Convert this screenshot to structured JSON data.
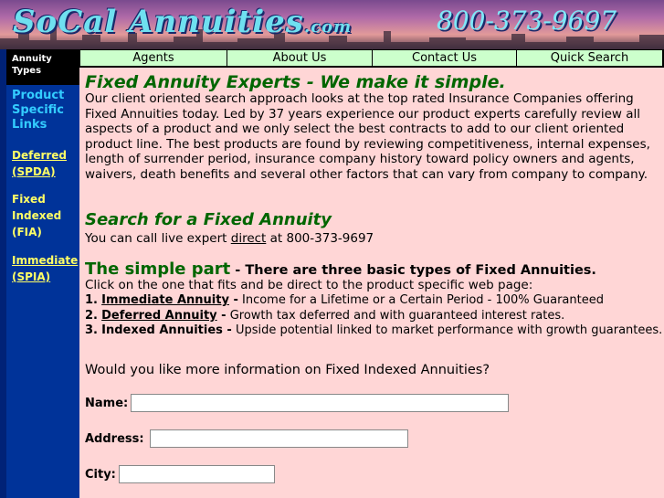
{
  "banner": {
    "logo_main": "SoCal Annuities",
    "logo_suffix": ".com",
    "phone": "800-373-9697"
  },
  "sidebar": {
    "header": "Annuity Types",
    "section_title": "Product Specific Links",
    "deferred": [
      "Deferred",
      "(SPDA)"
    ],
    "fixed_indexed": [
      "Fixed",
      "Indexed",
      "(FIA)"
    ],
    "immediate": [
      "Immediate",
      "(SPIA)"
    ]
  },
  "nav": {
    "tabs": [
      "Agents",
      "About Us",
      "Contact Us",
      "Quick Search"
    ]
  },
  "main": {
    "title": "Fixed Annuity Experts - We make it simple.",
    "intro": "Our client oriented search approach looks at the top rated Insurance Companies offering Fixed Annuities today. Led by 37 years experience our product experts carefully review all aspects of a product and we only select the best contracts to add to our client oriented product line. The best products are found by reviewing competitiveness, internal expenses, length of surrender period, insurance company history toward policy owners and agents, waivers, death benefits and several other factors that can vary from company to company.",
    "search_title": "Search for a Fixed Annuity",
    "call_prefix": "You can call live expert ",
    "call_link": "direct",
    "call_suffix": " at 800-373-9697",
    "simple_big": "The simple part",
    "simple_small": " - There are three basic types of Fixed Annuities.",
    "click_line": "Click on the one that fits and be direct to the product specific web page:",
    "types": [
      {
        "num": "1.",
        "name": "Immediate Annuity",
        "desc": " Income for a Lifetime or a Certain Period - 100% Guaranteed",
        "link": true
      },
      {
        "num": "2.",
        "name": "Deferred Annuity",
        "desc": " Growth tax deferred and with guaranteed interest rates.",
        "link": true
      },
      {
        "num": "3.",
        "name": "Indexed Annuities",
        "desc": " Upside potential linked to market performance with growth guarantees.",
        "link": false
      }
    ],
    "dash": " -",
    "question": "Would you like more information on Fixed Indexed Annuities?",
    "form": {
      "name_label": "Name:",
      "address_label": "Address:",
      "city_label": "City:",
      "name_value": "",
      "address_value": "",
      "city_value": ""
    }
  },
  "colors": {
    "sidebar_bg": "#003399",
    "nav_tab_bg": "#ccffcc",
    "page_bg": "#ffd6d6",
    "heading_green": "#006600",
    "link_yellow": "#ffff66",
    "section_cyan": "#33ccff"
  }
}
